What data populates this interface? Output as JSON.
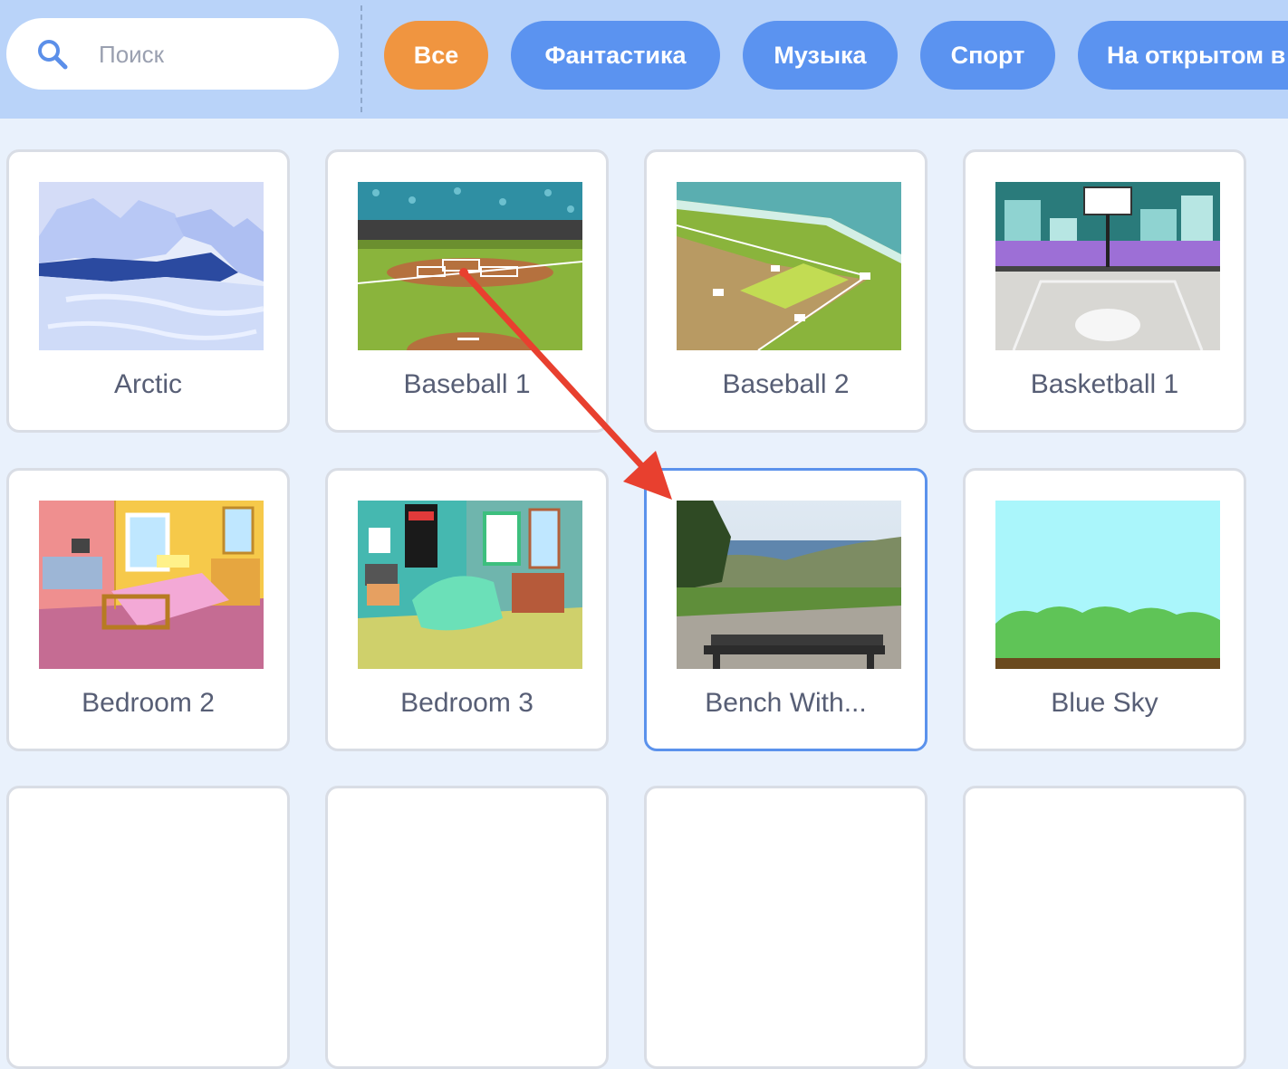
{
  "search": {
    "placeholder": "Поиск",
    "icon": "search-icon"
  },
  "categories": [
    {
      "label": "Все",
      "active": true
    },
    {
      "label": "Фантастика",
      "active": false
    },
    {
      "label": "Музыка",
      "active": false
    },
    {
      "label": "Спорт",
      "active": false
    },
    {
      "label": "На открытом в",
      "active": false
    }
  ],
  "backdrops": [
    {
      "name": "Arctic",
      "thumbnail": "arctic"
    },
    {
      "name": "Baseball 1",
      "thumbnail": "baseball-1"
    },
    {
      "name": "Baseball 2",
      "thumbnail": "baseball-2"
    },
    {
      "name": "Basketball 1",
      "thumbnail": "basketball-1"
    },
    {
      "name": "Bedroom 2",
      "thumbnail": "bedroom-2"
    },
    {
      "name": "Bedroom 3",
      "thumbnail": "bedroom-3"
    },
    {
      "name": "Bench With...",
      "thumbnail": "bench-with-view",
      "selected": true
    },
    {
      "name": "Blue Sky",
      "thumbnail": "blue-sky"
    }
  ],
  "colors": {
    "topbar": "#b9d3f9",
    "chip": "#5b93f0",
    "chip_active": "#f09540",
    "selected_border": "#5b92ec",
    "annotation_arrow": "#e8402f"
  }
}
